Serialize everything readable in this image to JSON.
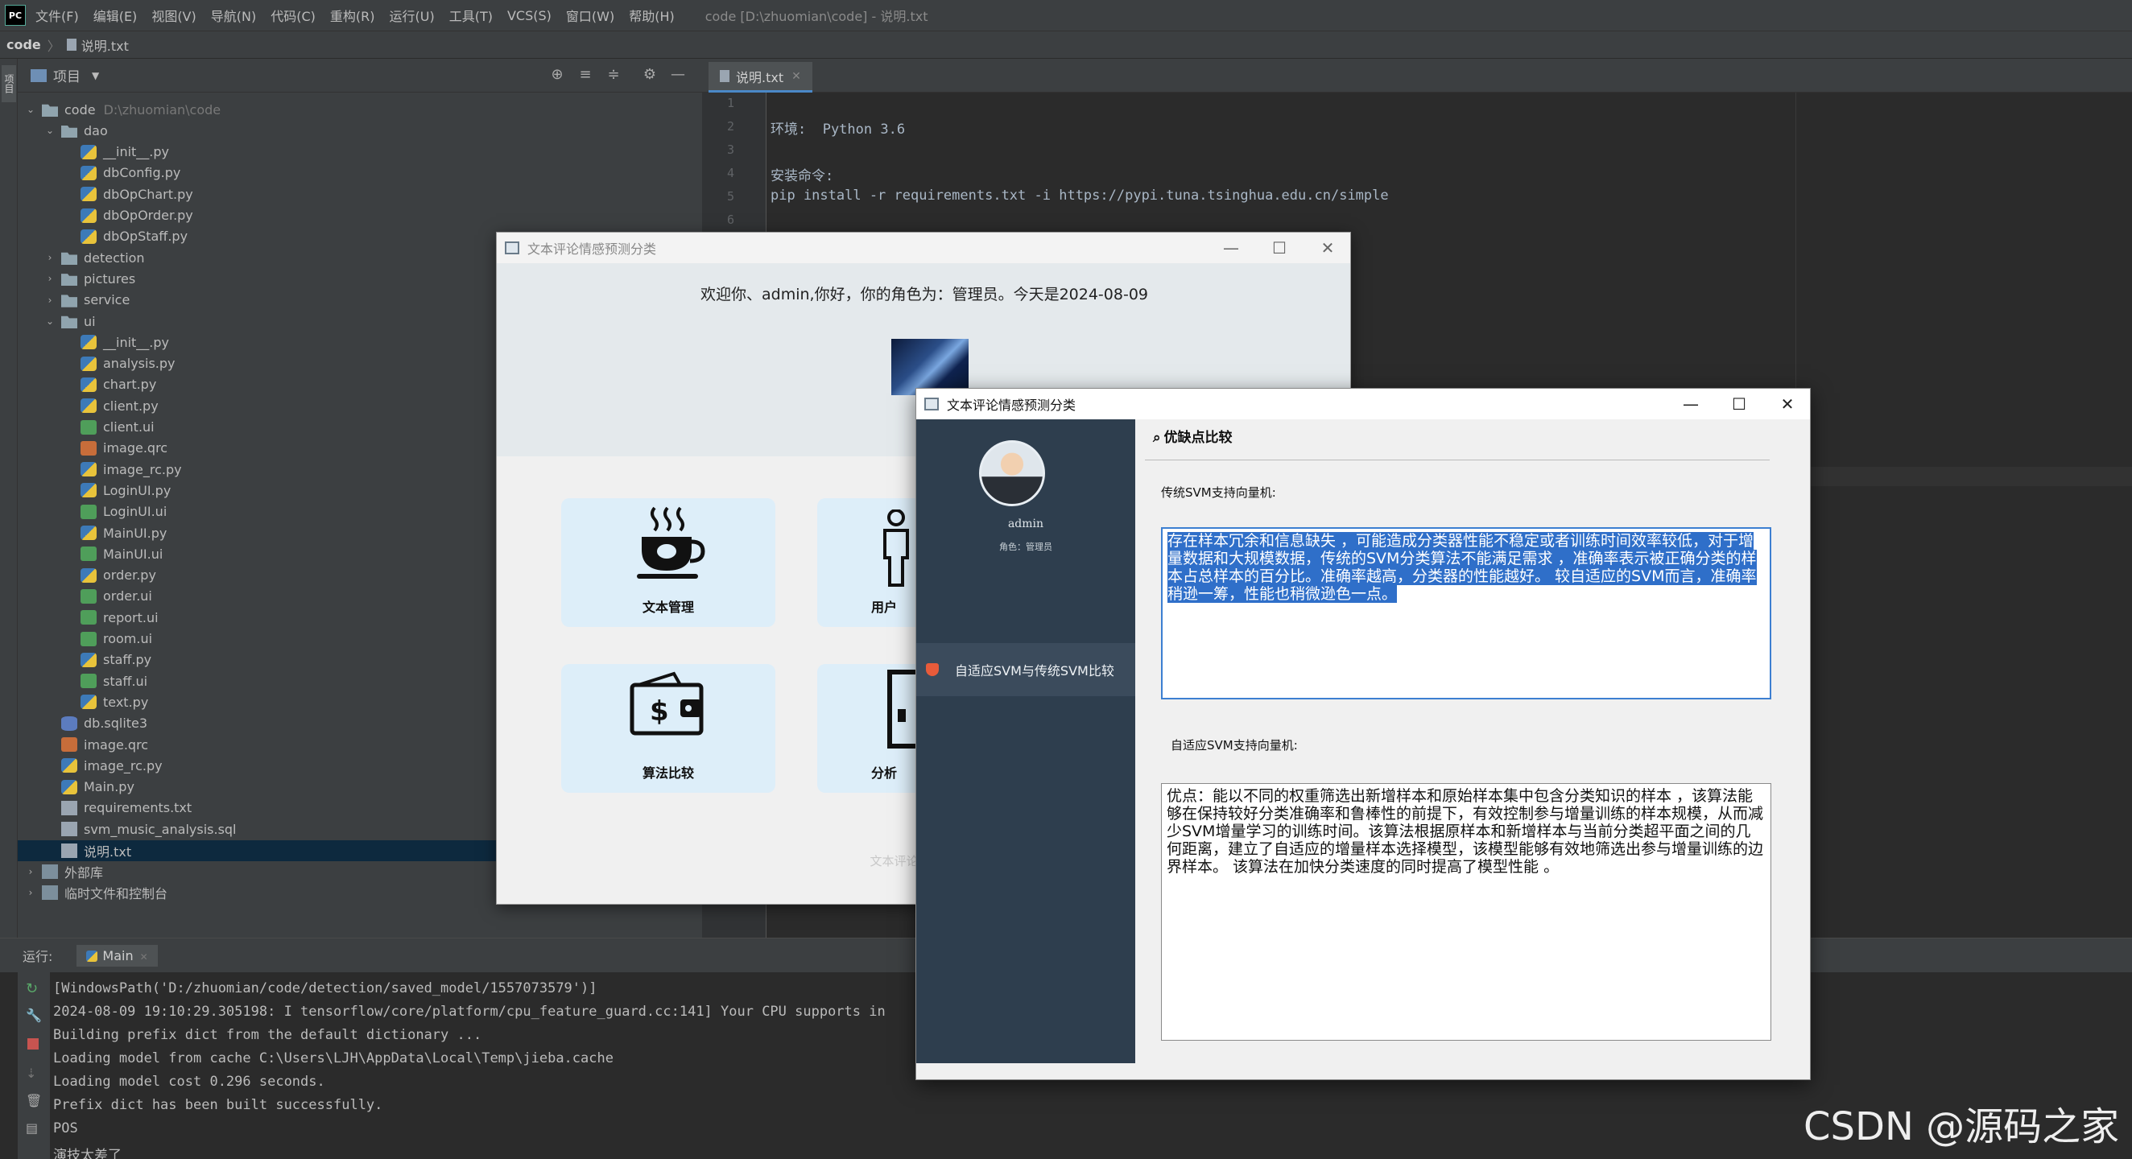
{
  "ide": {
    "logo": "PC",
    "menu": [
      "文件(F)",
      "编辑(E)",
      "视图(V)",
      "导航(N)",
      "代码(C)",
      "重构(R)",
      "运行(U)",
      "工具(T)",
      "VCS(S)",
      "窗口(W)",
      "帮助(H)"
    ],
    "window_title": "code [D:\\zhuomian\\code] - 说明.txt",
    "breadcrumb": [
      "code",
      "说明.txt"
    ],
    "left_strip_label": "项目",
    "project_panel_title": "项目",
    "tree": [
      {
        "label": "code",
        "path": "D:\\zhuomian\\code",
        "type": "folder",
        "level": 0,
        "expanded": true
      },
      {
        "label": "dao",
        "type": "folder",
        "level": 1,
        "expanded": true
      },
      {
        "label": "__init__.py",
        "type": "py",
        "level": 2
      },
      {
        "label": "dbConfig.py",
        "type": "py",
        "level": 2
      },
      {
        "label": "dbOpChart.py",
        "type": "py",
        "level": 2
      },
      {
        "label": "dbOpOrder.py",
        "type": "py",
        "level": 2
      },
      {
        "label": "dbOpStaff.py",
        "type": "py",
        "level": 2
      },
      {
        "label": "detection",
        "type": "folder",
        "level": 1,
        "expanded": false
      },
      {
        "label": "pictures",
        "type": "folder",
        "level": 1,
        "expanded": false
      },
      {
        "label": "service",
        "type": "folder",
        "level": 1,
        "expanded": false
      },
      {
        "label": "ui",
        "type": "folder",
        "level": 1,
        "expanded": true
      },
      {
        "label": "__init__.py",
        "type": "py",
        "level": 2
      },
      {
        "label": "analysis.py",
        "type": "py",
        "level": 2
      },
      {
        "label": "chart.py",
        "type": "py",
        "level": 2
      },
      {
        "label": "client.py",
        "type": "py",
        "level": 2
      },
      {
        "label": "client.ui",
        "type": "ui",
        "level": 2
      },
      {
        "label": "image.qrc",
        "type": "qrc",
        "level": 2
      },
      {
        "label": "image_rc.py",
        "type": "py",
        "level": 2
      },
      {
        "label": "LoginUI.py",
        "type": "py",
        "level": 2
      },
      {
        "label": "LoginUI.ui",
        "type": "ui",
        "level": 2
      },
      {
        "label": "MainUI.py",
        "type": "py",
        "level": 2
      },
      {
        "label": "MainUI.ui",
        "type": "ui",
        "level": 2
      },
      {
        "label": "order.py",
        "type": "py",
        "level": 2
      },
      {
        "label": "order.ui",
        "type": "ui",
        "level": 2
      },
      {
        "label": "report.ui",
        "type": "ui",
        "level": 2
      },
      {
        "label": "room.ui",
        "type": "ui",
        "level": 2
      },
      {
        "label": "staff.py",
        "type": "py",
        "level": 2
      },
      {
        "label": "staff.ui",
        "type": "ui",
        "level": 2
      },
      {
        "label": "text.py",
        "type": "py",
        "level": 2
      },
      {
        "label": "db.sqlite3",
        "type": "db",
        "level": 1
      },
      {
        "label": "image.qrc",
        "type": "qrc",
        "level": 1
      },
      {
        "label": "image_rc.py",
        "type": "py",
        "level": 1
      },
      {
        "label": "Main.py",
        "type": "py",
        "level": 1
      },
      {
        "label": "requirements.txt",
        "type": "txt",
        "level": 1
      },
      {
        "label": "svm_music_analysis.sql",
        "type": "txt",
        "level": 1
      },
      {
        "label": "说明.txt",
        "type": "txt",
        "level": 1,
        "selected": true
      },
      {
        "label": "外部库",
        "type": "lib",
        "level": 0,
        "expanded": false
      },
      {
        "label": "临时文件和控制台",
        "type": "lib",
        "level": 0,
        "expanded": false
      }
    ],
    "editor_tab": "说明.txt",
    "code_lines": [
      "",
      "环境:  Python 3.6",
      "",
      "安装命令:",
      "pip install -r requirements.txt -i https://pypi.tuna.tsinghua.edu.cn/simple",
      ""
    ],
    "line_numbers": [
      "1",
      "2",
      "3",
      "4",
      "5",
      "6"
    ],
    "run_label": "运行:",
    "run_tab": "Main",
    "output": [
      "[WindowsPath('D:/zhuomian/code/detection/saved_model/1557073579')]",
      "2024-08-09 19:10:29.305198: I tensorflow/core/platform/cpu_feature_guard.cc:141] Your CPU supports in",
      "Building prefix dict from the default dictionary ...",
      "Loading model from cache C:\\Users\\LJH\\AppData\\Local\\Temp\\jieba.cache",
      "Loading model cost 0.296 seconds.",
      "Prefix dict has been built successfully.",
      "POS",
      "演技太差了"
    ]
  },
  "win1": {
    "title": "文本评论情感预测分类",
    "welcome": "欢迎你、admin,你好，你的角色为：管理员。今天是2024-08-09",
    "cards": [
      "文本管理",
      "用户",
      "算法比较",
      "分析"
    ],
    "footer": "文本评论情感预测分"
  },
  "win2": {
    "title": "文本评论情感预测分类",
    "username": "admin",
    "role": "角色：管理员",
    "menu_item": "自适应SVM与传统SVM比较",
    "section_title": "优缺点比较",
    "label1": "传统SVM支持向量机:",
    "text1": "存在样本冗余和信息缺失 ，可能造成分类器性能不稳定或者训练时间效率较低，对于增量数据和大规模数据，传统的SVM分类算法不能满足需求 ，准确率表示被正确分类的样本占总样本的百分比。准确率越高，分类器的性能越好。 较自适应的SVM而言，准确率稍逊一筹，性能也稍微逊色一点。",
    "label2": "自适应SVM支持向量机:",
    "text2": "优点：能以不同的权重筛选出新增样本和原始样本集中包含分类知识的样本 ，该算法能够在保持较好分类准确率和鲁棒性的前提下，有效控制参与增量训练的样本规模，从而减少SVM增量学习的训练时间。该算法根据原样本和新增样本与当前分类超平面之间的几何距离，建立了自适应的增量样本选择模型，该模型能够有效地筛选出参与增量训练的边界样本。 该算法在加快分类速度的同时提高了模型性能 。"
  },
  "watermark": "CSDN @源码之家"
}
